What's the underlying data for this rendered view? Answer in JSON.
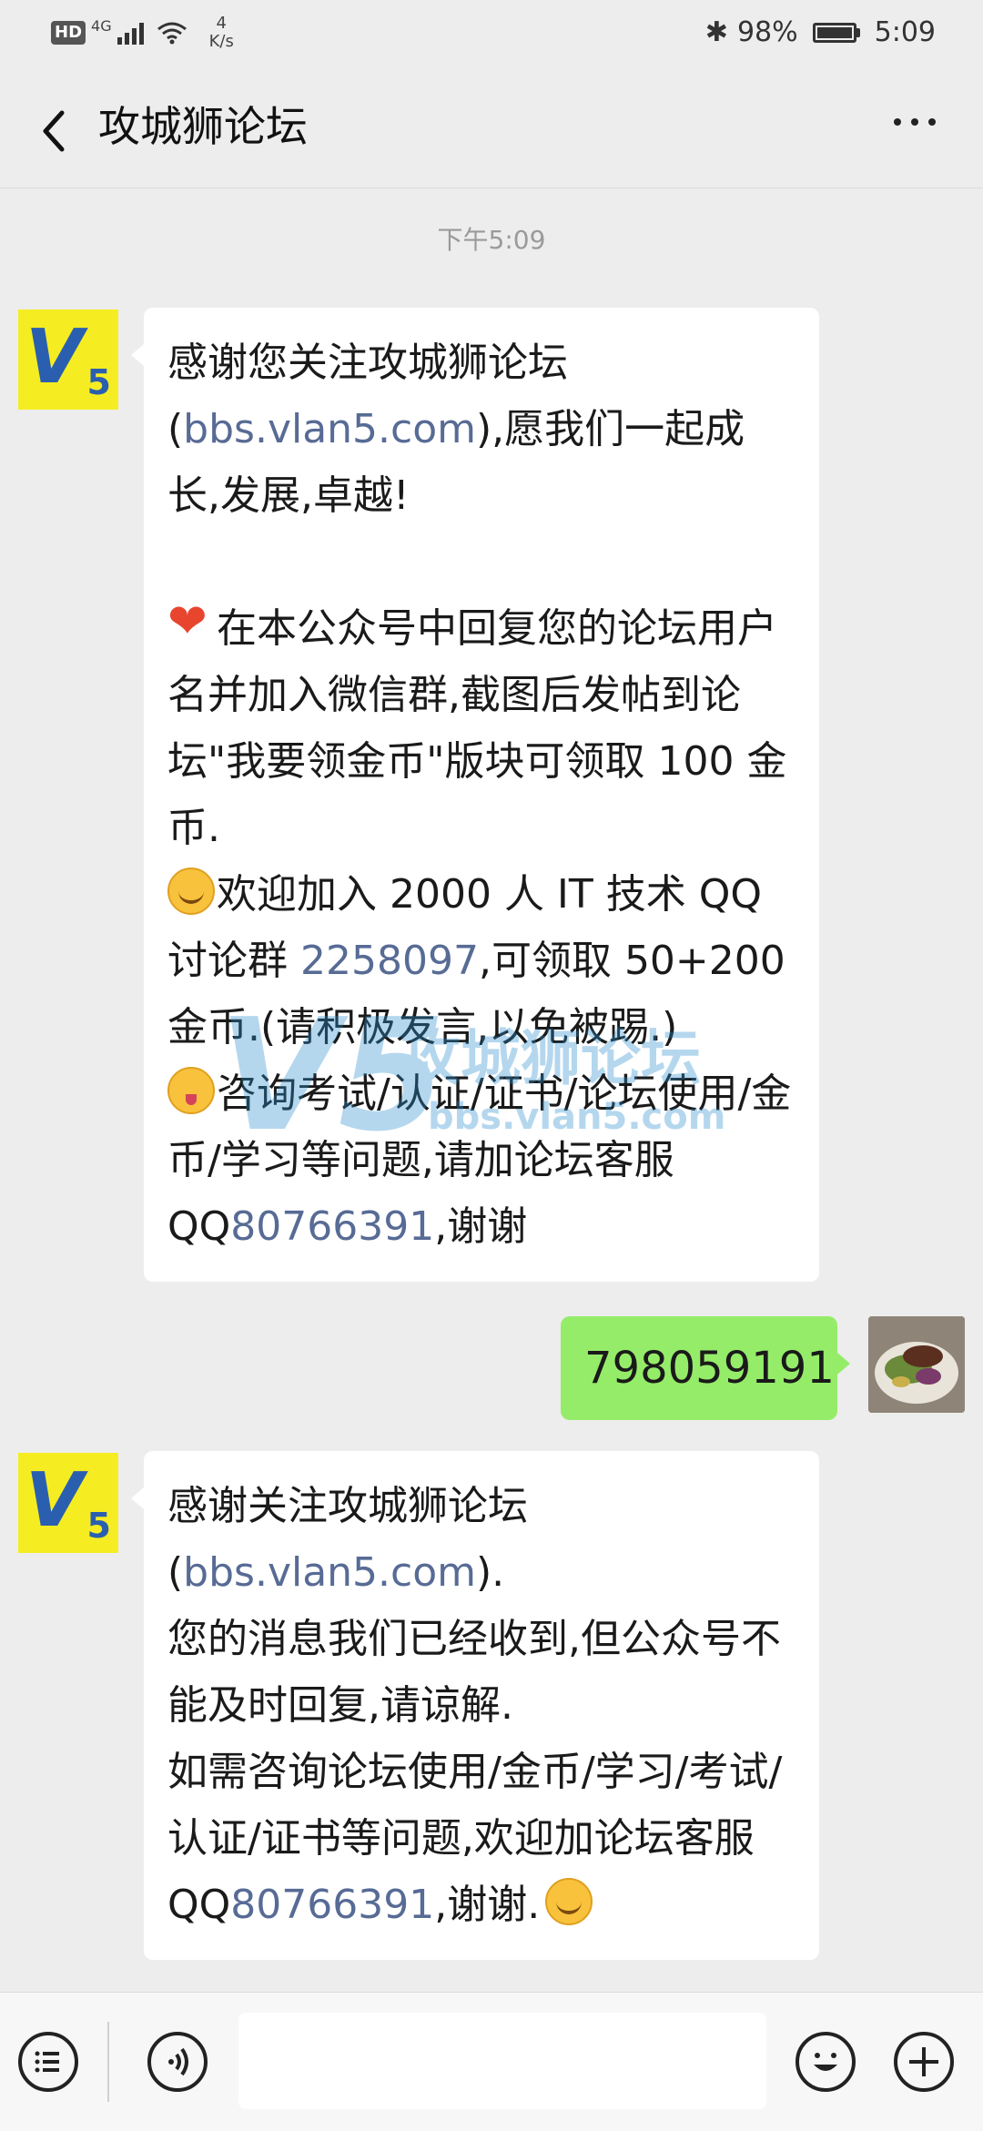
{
  "status_bar": {
    "hd": "HD",
    "network": "4G",
    "speed_value": "4",
    "speed_unit": "K/s",
    "battery": "98%",
    "time": "5:09"
  },
  "header": {
    "title": "攻城狮论坛"
  },
  "timestamp": "下午5:09",
  "messages": {
    "welcome": {
      "p1_a": "感谢您关注攻城狮论坛(",
      "p1_link": "bbs.vlan5.com",
      "p1_b": "),愿我们一起成长,发展,卓越!",
      "p2": "在本公众号中回复您的论坛用户名并加入微信群,截图后发帖到论坛\"我要领金币\"版块可领取 100 金币.",
      "p3_a": "欢迎加入 2000 人 IT 技术 QQ 讨论群 ",
      "p3_link": "2258097",
      "p3_b": ",可领取 50+200 金币.(请积极发言,以免被踢.)",
      "p4_a": "咨询考试/认证/证书/论坛使用/金币/学习等问题,请加论坛客服 QQ",
      "p4_link": "80766391",
      "p4_b": ",谢谢"
    },
    "sent": "798059191",
    "reply": {
      "p1_a": "感谢关注攻城狮论坛(",
      "p1_link": "bbs.vlan5.com",
      "p1_b": ").",
      "p2": "您的消息我们已经收到,但公众号不能及时回复,请谅解.",
      "p3_a": "如需咨询论坛使用/金币/学习/考试/认证/证书等问题,欢迎加论坛客服 QQ",
      "p3_link": "80766391",
      "p3_b": ",谢谢."
    }
  },
  "avatar": {
    "letter": "V",
    "number": "5"
  },
  "watermark": {
    "name": "攻城狮论坛",
    "url": "bbs.vlan5.com"
  },
  "colors": {
    "link": "#576b95",
    "sent_bubble": "#95ec69",
    "avatar_bg": "#f5ed22"
  }
}
